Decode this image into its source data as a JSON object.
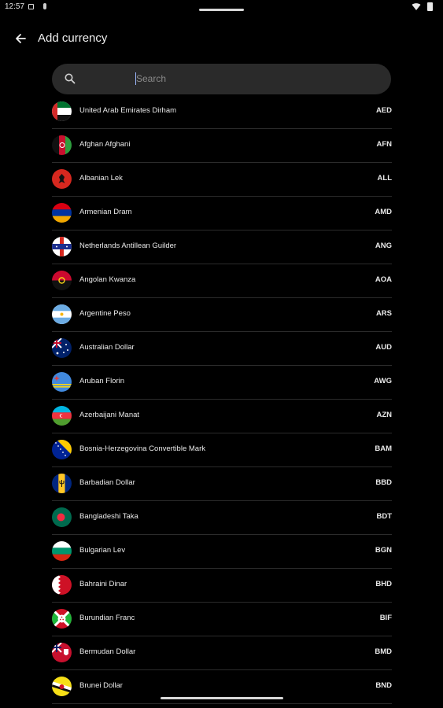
{
  "status_bar": {
    "time": "12:57",
    "icons": [
      "notification-icon",
      "mic-icon",
      "wifi-icon",
      "battery-icon"
    ]
  },
  "app_bar": {
    "title": "Add currency",
    "back_icon": "arrow-back-icon"
  },
  "search": {
    "placeholder": "Search",
    "value": ""
  },
  "currencies": [
    {
      "name": "United Arab Emirates Dirham",
      "code": "AED"
    },
    {
      "name": "Afghan Afghani",
      "code": "AFN"
    },
    {
      "name": "Albanian Lek",
      "code": "ALL"
    },
    {
      "name": "Armenian Dram",
      "code": "AMD"
    },
    {
      "name": "Netherlands Antillean Guilder",
      "code": "ANG"
    },
    {
      "name": "Angolan Kwanza",
      "code": "AOA"
    },
    {
      "name": "Argentine Peso",
      "code": "ARS"
    },
    {
      "name": "Australian Dollar",
      "code": "AUD"
    },
    {
      "name": "Aruban Florin",
      "code": "AWG"
    },
    {
      "name": "Azerbaijani Manat",
      "code": "AZN"
    },
    {
      "name": "Bosnia-Herzegovina Convertible Mark",
      "code": "BAM"
    },
    {
      "name": "Barbadian Dollar",
      "code": "BBD"
    },
    {
      "name": "Bangladeshi Taka",
      "code": "BDT"
    },
    {
      "name": "Bulgarian Lev",
      "code": "BGN"
    },
    {
      "name": "Bahraini Dinar",
      "code": "BHD"
    },
    {
      "name": "Burundian Franc",
      "code": "BIF"
    },
    {
      "name": "Bermudan Dollar",
      "code": "BMD"
    },
    {
      "name": "Brunei Dollar",
      "code": "BND"
    }
  ]
}
